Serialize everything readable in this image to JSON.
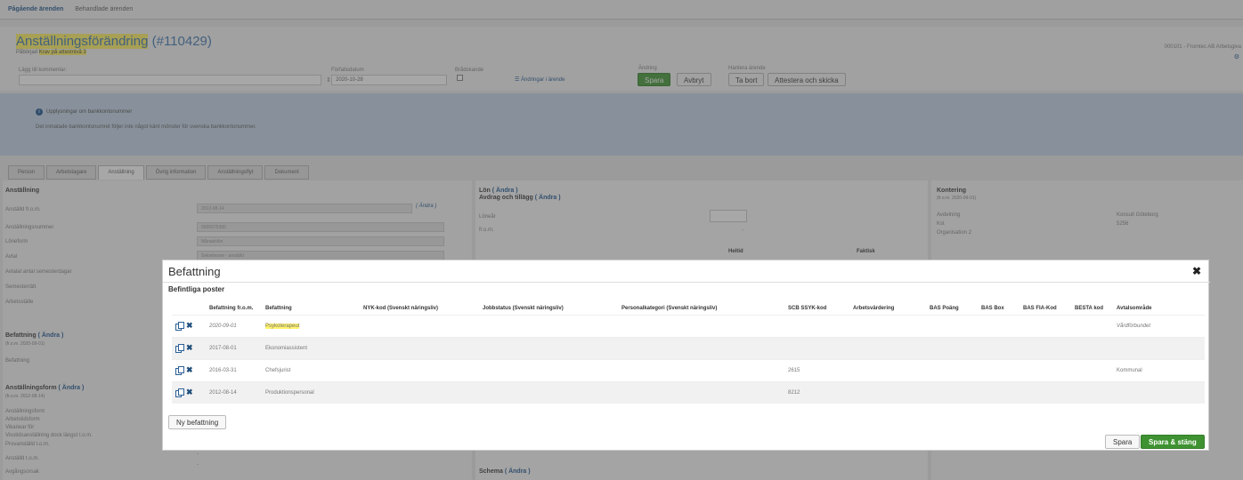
{
  "topnav": {
    "active_tab": "Pågående ärenden",
    "other_tab": "Behandlade ärenden"
  },
  "header": {
    "title": "Anställningsförändring",
    "case_number": "(#110429)",
    "subtitle_prefix": "Påbörjad",
    "subtitle_status": "Krav på attestnivå 3",
    "company": "000101 - Fromtec AB Arbetsgiva",
    "comment_label": "Lägg till kommentar:",
    "date_label": "Förfallodatum",
    "date_value": "2020-10-28",
    "urgent_label": "Brådskande",
    "changes_link": "Ändringar i ärende",
    "change_label": "Ändring",
    "handle_label": "Hantera ärende",
    "save": "Spara",
    "cancel": "Avbryt",
    "delete": "Ta bort",
    "attest": "Attestera och skicka"
  },
  "info": {
    "title": "Upplysningar om bankkontonummer",
    "text": "Det inmatade bankkontonumret följer inte något känt mönster för svenska bankkontonummer."
  },
  "tabs": [
    "Person",
    "Arbetstagare",
    "Anställning",
    "Övrig information",
    "Anställningsflyt",
    "Dokument"
  ],
  "left_panel": {
    "heading": "Anställning",
    "rows": [
      "Anställd fr.o.m.",
      "Anställningsnummer",
      "Löneform",
      "Avtal",
      "Avtalat antal semesterdagar",
      "Semesterrätt",
      "Arbetsställe"
    ],
    "values": [
      "2012-08-14",
      "0000075300",
      "Månadslön",
      "Sekreterare - anställd"
    ],
    "change": "( Ändra )",
    "befattning_heading": "Befattning",
    "befattning_link": "( Ändra )",
    "befattning_from": "(fr.o.m. 2020-09-01)",
    "befattning_row": "Befattning",
    "form_heading": "Anställningsform",
    "form_link": "( Ändra )",
    "form_from": "(fr.o.m. 2012-08-14)",
    "form_rows": [
      "Anställningsform",
      "Arbetstidsform",
      "Vikariear för",
      "Visstidsanställning dock längst t.o.m.",
      "Provanställd t.o.m.",
      "Anställd t.o.m.",
      "Avgångsorsak"
    ],
    "form_values": [
      "-",
      "-"
    ]
  },
  "mid_panel": {
    "lon": "Lön",
    "lon_link": "( Ändra )",
    "avdrag": "Avdrag och tillägg",
    "avdrag_link": "( Ändra )",
    "lonear": "Löneår",
    "from": "fr.o.m.",
    "from_value": "-",
    "heltid": "Heltid",
    "faktisk": "Faktisk",
    "schema": "Schema",
    "schema_link": "( Ändra )"
  },
  "right_panel": {
    "heading": "Kontering",
    "from": "(fr.o.m. 2020-09-01)",
    "rows": [
      "Avdelning",
      "Kst",
      "Organisation 2"
    ],
    "values": [
      "Konsult Göteborg",
      "5256"
    ]
  },
  "modal": {
    "title": "Befattning",
    "section": "Befintliga poster",
    "close_icon": "close-icon",
    "columns": [
      "Befattning fr.o.m.",
      "Befattning",
      "NYK-kod (Svenskt näringsliv)",
      "Jobbstatus (Svenskt näringsliv)",
      "Personalkategori (Svenskt näringsliv)",
      "SCB SSYK-kod",
      "Arbetsvärdering",
      "BAS Poäng",
      "BAS Box",
      "BAS FIA-Kod",
      "BESTA kod",
      "Avtalsområde"
    ],
    "rows": [
      {
        "date": "2020-09-01",
        "befattning": "Psykoterapeut",
        "ssyk": "",
        "avtal": "Vårdförbundet"
      },
      {
        "date": "2017-08-01",
        "befattning": "Ekonomiassistent",
        "ssyk": "",
        "avtal": ""
      },
      {
        "date": "2016-03-31",
        "befattning": "Chefsjurist",
        "ssyk": "2615",
        "avtal": "Kommunal"
      },
      {
        "date": "2012-08-14",
        "befattning": "Produktionspersonal",
        "ssyk": "8212",
        "avtal": ""
      }
    ],
    "new_button": "Ny befattning",
    "save": "Spara",
    "save_close": "Spara & stäng"
  }
}
